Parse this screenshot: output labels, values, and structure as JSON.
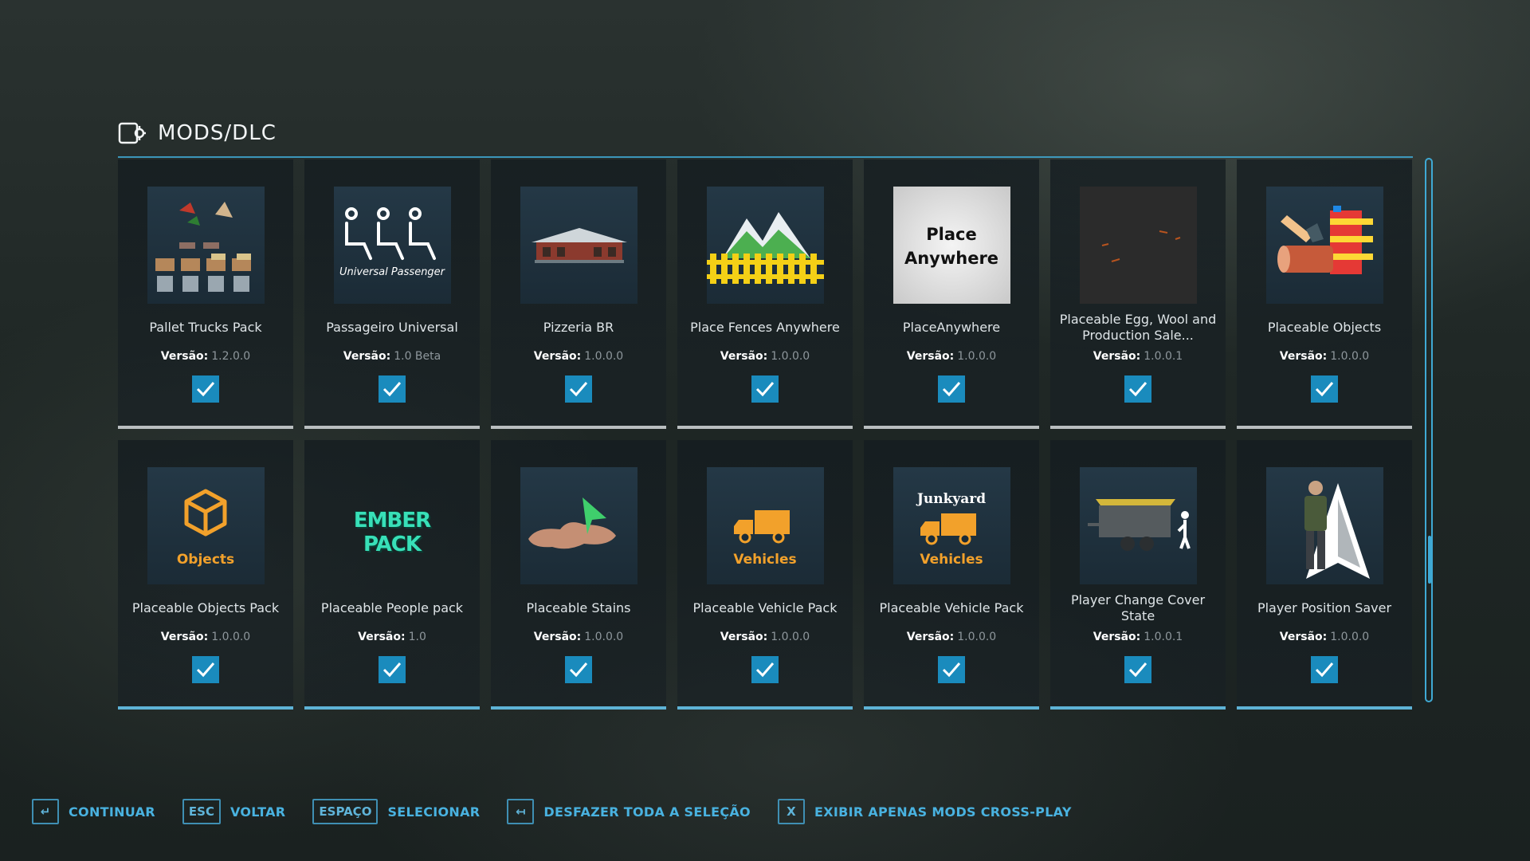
{
  "header": {
    "title": "MODS/DLC",
    "icon": "mods-dlc-icon"
  },
  "version_label": "Versão:",
  "mods": [
    {
      "name": "Pallet Trucks Pack",
      "version": "1.2.0.0",
      "checked": true
    },
    {
      "name": "Passageiro Universal",
      "version": "1.0 Beta",
      "checked": true,
      "thumb_text": "Universal Passenger"
    },
    {
      "name": "Pizzeria BR",
      "version": "1.0.0.0",
      "checked": true
    },
    {
      "name": "Place Fences Anywhere",
      "version": "1.0.0.0",
      "checked": true
    },
    {
      "name": "PlaceAnywhere",
      "version": "1.0.0.0",
      "checked": true,
      "thumb_text_1": "Place",
      "thumb_text_2": "Anywhere"
    },
    {
      "name": "Placeable Egg, Wool and Production Sale...",
      "version": "1.0.0.1",
      "checked": true
    },
    {
      "name": "Placeable Objects",
      "version": "1.0.0.0",
      "checked": true
    },
    {
      "name": "Placeable Objects Pack",
      "version": "1.0.0.0",
      "checked": true,
      "thumb_text": "Objects"
    },
    {
      "name": "Placeable People pack",
      "version": "1.0",
      "checked": true,
      "thumb_text": "EMBER PACK"
    },
    {
      "name": "Placeable Stains",
      "version": "1.0.0.0",
      "checked": true
    },
    {
      "name": "Placeable Vehicle Pack",
      "version": "1.0.0.0",
      "checked": true,
      "thumb_text": "Vehicles"
    },
    {
      "name": "Placeable Vehicle Pack",
      "version": "1.0.0.0",
      "checked": true,
      "thumb_text_1": "Junkyard",
      "thumb_text_2": "Vehicles"
    },
    {
      "name": "Player Change Cover State",
      "version": "1.0.0.1",
      "checked": true
    },
    {
      "name": "Player Position Saver",
      "version": "1.0.0.0",
      "checked": true
    }
  ],
  "footer": [
    {
      "key": "↵",
      "label": "CONTINUAR"
    },
    {
      "key": "ESC",
      "label": "VOLTAR"
    },
    {
      "key": "ESPAÇO",
      "label": "SELECIONAR"
    },
    {
      "key": "↤",
      "label": "DESFAZER TODA A SELEÇÃO"
    },
    {
      "key": "X",
      "label": "EXIBIR APENAS MODS CROSS-PLAY"
    }
  ],
  "colors": {
    "accent": "#3fa9d4",
    "check": "#1a8bbd",
    "orange": "#f2a12b"
  }
}
